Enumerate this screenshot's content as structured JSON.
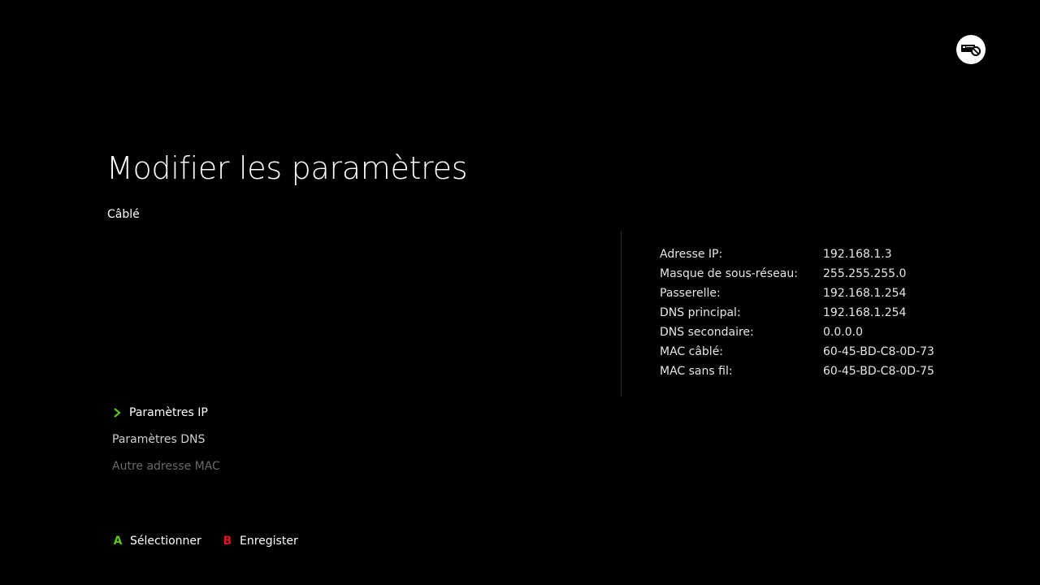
{
  "header": {
    "title": "Modifier les paramètres",
    "connection_type": "Câblé",
    "status_icon": "network-disconnected-icon"
  },
  "network_info": [
    {
      "label": "Adresse IP:",
      "value": "192.168.1.3"
    },
    {
      "label": "Masque de sous-réseau:",
      "value": "255.255.255.0"
    },
    {
      "label": "Passerelle:",
      "value": "192.168.1.254"
    },
    {
      "label": "DNS principal:",
      "value": "192.168.1.254"
    },
    {
      "label": "DNS secondaire:",
      "value": "0.0.0.0"
    },
    {
      "label": "MAC câblé:",
      "value": "60-45-BD-C8-0D-73"
    },
    {
      "label": "MAC sans fil:",
      "value": "60-45-BD-C8-0D-75"
    }
  ],
  "menu": {
    "items": [
      {
        "label": "Paramètres IP",
        "state": "selected"
      },
      {
        "label": "Paramètres DNS",
        "state": "normal"
      },
      {
        "label": "Autre adresse MAC",
        "state": "disabled"
      }
    ]
  },
  "footer": {
    "select": {
      "button": "A",
      "label": "Sélectionner",
      "color": "#5dc21e"
    },
    "save": {
      "button": "B",
      "label": "Enregister",
      "color": "#e81123"
    }
  },
  "colors": {
    "background": "#000000",
    "accent": "#5dc21e",
    "text": "#ffffff",
    "disabled_text": "#6a6a6a"
  }
}
